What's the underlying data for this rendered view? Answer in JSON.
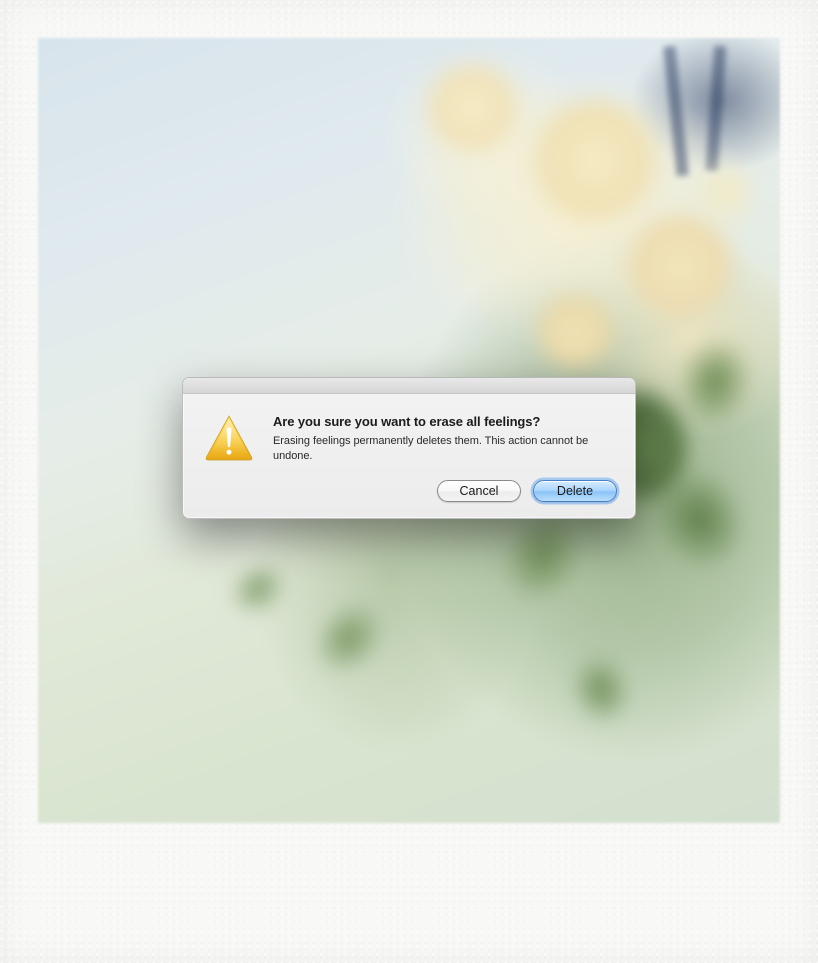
{
  "dialog": {
    "title": "Are you sure you want to erase all feelings?",
    "message": "Erasing feelings permanently deletes them. This action cannot be undone.",
    "cancel_label": "Cancel",
    "confirm_label": "Delete"
  }
}
